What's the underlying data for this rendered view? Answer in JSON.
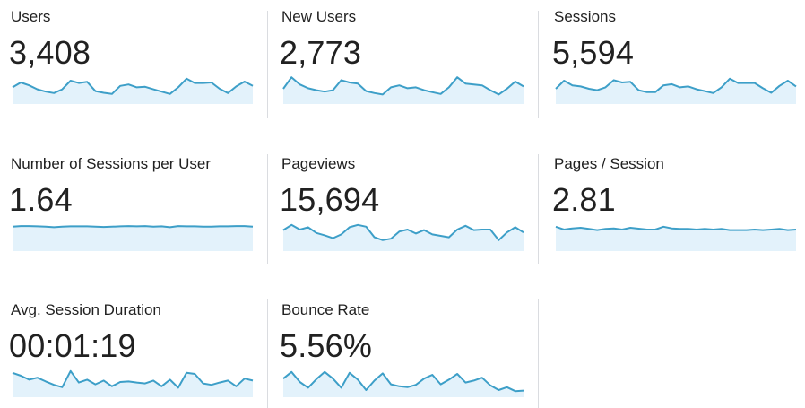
{
  "metrics": [
    {
      "label": "Users",
      "value": "3,408",
      "trend": [
        0.55,
        0.72,
        0.62,
        0.48,
        0.4,
        0.35,
        0.48,
        0.78,
        0.7,
        0.74,
        0.42,
        0.36,
        0.32,
        0.6,
        0.65,
        0.55,
        0.57,
        0.48,
        0.4,
        0.32,
        0.55,
        0.85,
        0.7,
        0.7,
        0.72,
        0.5,
        0.35,
        0.58,
        0.75,
        0.6
      ]
    },
    {
      "label": "New Users",
      "value": "2,773",
      "trend": [
        0.5,
        0.9,
        0.65,
        0.52,
        0.45,
        0.4,
        0.45,
        0.8,
        0.72,
        0.68,
        0.42,
        0.35,
        0.3,
        0.55,
        0.62,
        0.52,
        0.55,
        0.45,
        0.38,
        0.32,
        0.55,
        0.9,
        0.68,
        0.65,
        0.62,
        0.45,
        0.3,
        0.5,
        0.75,
        0.58
      ]
    },
    {
      "label": "Sessions",
      "value": "5,594",
      "trend": [
        0.5,
        0.78,
        0.62,
        0.58,
        0.5,
        0.45,
        0.55,
        0.8,
        0.72,
        0.74,
        0.45,
        0.38,
        0.38,
        0.62,
        0.66,
        0.55,
        0.58,
        0.48,
        0.42,
        0.35,
        0.55,
        0.85,
        0.7,
        0.7,
        0.7,
        0.52,
        0.36,
        0.6,
        0.78,
        0.58
      ]
    },
    {
      "label": "Number of Sessions per User",
      "value": "1.64",
      "trend": [
        0.82,
        0.84,
        0.84,
        0.83,
        0.82,
        0.8,
        0.82,
        0.83,
        0.83,
        0.83,
        0.82,
        0.81,
        0.82,
        0.83,
        0.84,
        0.83,
        0.84,
        0.82,
        0.83,
        0.8,
        0.84,
        0.83,
        0.83,
        0.82,
        0.82,
        0.83,
        0.83,
        0.84,
        0.84,
        0.82
      ]
    },
    {
      "label": "Pageviews",
      "value": "15,694",
      "trend": [
        0.7,
        0.88,
        0.72,
        0.8,
        0.6,
        0.52,
        0.42,
        0.55,
        0.8,
        0.88,
        0.82,
        0.45,
        0.35,
        0.4,
        0.65,
        0.72,
        0.58,
        0.7,
        0.55,
        0.5,
        0.45,
        0.72,
        0.85,
        0.7,
        0.72,
        0.72,
        0.35,
        0.62,
        0.8,
        0.62
      ]
    },
    {
      "label": "Pages / Session",
      "value": "2.81",
      "trend": [
        0.82,
        0.72,
        0.76,
        0.78,
        0.74,
        0.7,
        0.74,
        0.76,
        0.72,
        0.78,
        0.75,
        0.72,
        0.72,
        0.82,
        0.76,
        0.74,
        0.74,
        0.72,
        0.74,
        0.72,
        0.74,
        0.7,
        0.7,
        0.7,
        0.72,
        0.7,
        0.72,
        0.74,
        0.7,
        0.72
      ]
    },
    {
      "label": "Avg. Session Duration",
      "value": "00:01:19",
      "trend": [
        0.82,
        0.72,
        0.58,
        0.65,
        0.52,
        0.4,
        0.32,
        0.88,
        0.48,
        0.58,
        0.42,
        0.55,
        0.35,
        0.5,
        0.52,
        0.48,
        0.45,
        0.55,
        0.35,
        0.58,
        0.3,
        0.82,
        0.78,
        0.45,
        0.4,
        0.48,
        0.55,
        0.35,
        0.62,
        0.55
      ]
    },
    {
      "label": "Bounce Rate",
      "value": "5.56%",
      "trend": [
        0.62,
        0.85,
        0.5,
        0.3,
        0.6,
        0.85,
        0.62,
        0.3,
        0.82,
        0.58,
        0.22,
        0.55,
        0.8,
        0.42,
        0.35,
        0.32,
        0.4,
        0.62,
        0.75,
        0.42,
        0.58,
        0.78,
        0.48,
        0.55,
        0.65,
        0.38,
        0.22,
        0.32,
        0.18,
        0.2
      ]
    }
  ],
  "colors": {
    "line": "#3d9fc8",
    "fill": "#e3f2fb",
    "divider": "#dadce0"
  }
}
